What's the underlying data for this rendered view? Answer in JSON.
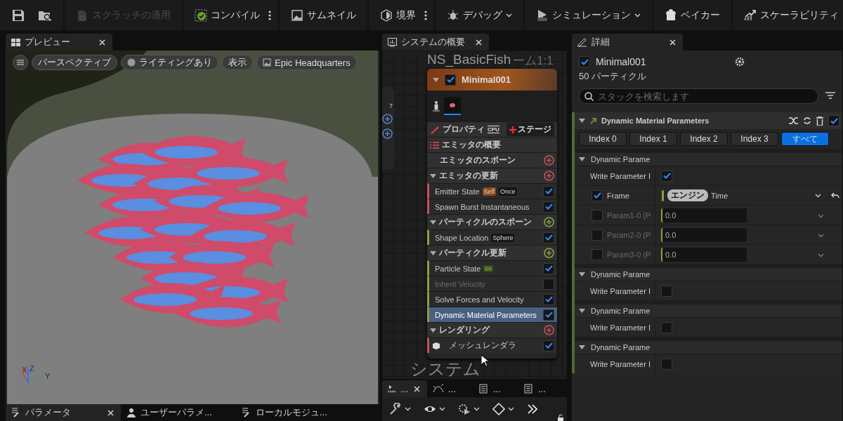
{
  "toolbar": {
    "items": [
      {
        "label": "スクラッチの適用",
        "disabled": true,
        "more": false,
        "dropdown": false
      },
      {
        "label": "コンパイル",
        "disabled": false,
        "more": true,
        "dropdown": false
      },
      {
        "label": "サムネイル",
        "disabled": false,
        "more": false,
        "dropdown": false
      },
      {
        "label": "境界",
        "disabled": false,
        "more": true,
        "dropdown": false
      },
      {
        "label": "デバッグ",
        "disabled": false,
        "more": false,
        "dropdown": true
      },
      {
        "label": "シミュレーション",
        "disabled": false,
        "more": false,
        "dropdown": true
      },
      {
        "label": "ベイカー",
        "disabled": false,
        "more": false,
        "dropdown": false
      },
      {
        "label": "スケーラビリティ",
        "disabled": false,
        "more": false,
        "dropdown": false
      }
    ]
  },
  "preview": {
    "tab": "プレビュー",
    "view_buttons": [
      "パースペクティブ",
      "ライティングあり",
      "表示",
      "Epic Headquarters"
    ],
    "axes": [
      "X",
      "Z",
      "Y"
    ]
  },
  "bottom_tabs": [
    {
      "label": "パラメータ",
      "selected": true
    },
    {
      "label": "ユーザーパラメ...",
      "selected": false
    },
    {
      "label": "ローカルモジュ...",
      "selected": false
    }
  ],
  "system_overview": {
    "tab": "システムの概要",
    "graph_title": "NS_BasicFish",
    "graph_zoom": "ーム1:1",
    "watermark": "システム",
    "side_node_text": "7",
    "node": {
      "name": "Minimal001",
      "enabled": true,
      "properties": "プロパティ",
      "sim_target": "CPU",
      "add_stage": "ステージ",
      "summary": "エミッタの概要",
      "sections": [
        {
          "title": "エミッタのスポーン",
          "collapsible": false,
          "color": "#c8505a"
        },
        {
          "title": "エミッタの更新",
          "collapsible": true,
          "color": "#c8505a",
          "rows": [
            {
              "kind": "module",
              "label": "Emitter State",
              "tags": [
                {
                  "text": "Self",
                  "kind": "scope"
                },
                {
                  "text": "Once",
                  "kind": "mode"
                }
              ],
              "enabled": true,
              "selected": false
            },
            {
              "kind": "module",
              "label": "Spawn Burst Instantaneous",
              "tags": [],
              "enabled": true,
              "selected": false
            }
          ]
        },
        {
          "title": "パーティクルのスポーン",
          "collapsible": true,
          "color": "#8aa040",
          "rows": [
            {
              "kind": "module",
              "label": "Shape Location",
              "tags": [
                {
                  "text": "Sphere",
                  "kind": "mode"
                }
              ],
              "enabled": true,
              "selected": false
            }
          ]
        },
        {
          "title": "パーティクル更新",
          "collapsible": true,
          "color": "#8aa040",
          "rows": [
            {
              "kind": "module_loop",
              "label": "Particle State",
              "tags": [],
              "enabled": true,
              "selected": false
            },
            {
              "kind": "module",
              "label": "Inherit Velocity",
              "tags": [],
              "enabled": false,
              "selected": false
            },
            {
              "kind": "module",
              "label": "Solve Forces and Velocity",
              "tags": [],
              "enabled": true,
              "selected": false
            },
            {
              "kind": "module",
              "label": "Dynamic Material Parameters",
              "tags": [],
              "enabled": true,
              "selected": true
            }
          ]
        },
        {
          "title": "レンダリング",
          "collapsible": true,
          "color": "#c8505a",
          "rows": [
            {
              "kind": "renderer",
              "label": "メッシュレンダラ",
              "tags": [],
              "enabled": true,
              "selected": false
            }
          ]
        }
      ]
    }
  },
  "stack_tabs": [
    {
      "label": "...",
      "selected": true
    },
    {
      "label": "...",
      "selected": false
    },
    {
      "label": "...",
      "selected": false
    },
    {
      "label": "...",
      "selected": false
    }
  ],
  "details": {
    "tab": "詳細",
    "emitter": {
      "name": "Minimal001",
      "enabled": true
    },
    "particle_count": "50 パーティクル",
    "search_placeholder": "スタックを検索します",
    "module": {
      "name": "Dynamic Material Parameters",
      "enabled": true
    },
    "index_tabs": [
      {
        "label": "Index 0",
        "selected": false
      },
      {
        "label": "Index 1",
        "selected": false
      },
      {
        "label": "Index 2",
        "selected": false
      },
      {
        "label": "Index 3",
        "selected": false
      },
      {
        "label": "すべて",
        "selected": true
      }
    ],
    "groups": [
      {
        "title": "Dynamic Parame",
        "rows": [
          {
            "kind": "toggle",
            "label": "Write Parameter I",
            "checked": true
          },
          {
            "kind": "binding",
            "label": "Frame",
            "checked": true,
            "chip": "エンジン",
            "value": "Time"
          },
          {
            "kind": "number",
            "label": "Param1-0 (P",
            "checked": false,
            "value": "0.0"
          },
          {
            "kind": "number",
            "label": "Param2-0 (P",
            "checked": false,
            "value": "0.0"
          },
          {
            "kind": "number",
            "label": "Param3-0 (P",
            "checked": false,
            "value": "0.0"
          }
        ]
      },
      {
        "title": "Dynamic Parame",
        "rows": [
          {
            "kind": "toggle",
            "label": "Write Parameter I",
            "checked": false
          }
        ]
      },
      {
        "title": "Dynamic Parame",
        "rows": [
          {
            "kind": "toggle",
            "label": "Write Parameter I",
            "checked": false
          }
        ]
      },
      {
        "title": "Dynamic Parame",
        "rows": [
          {
            "kind": "toggle",
            "label": "Write Parameter I",
            "checked": false
          }
        ]
      }
    ]
  }
}
